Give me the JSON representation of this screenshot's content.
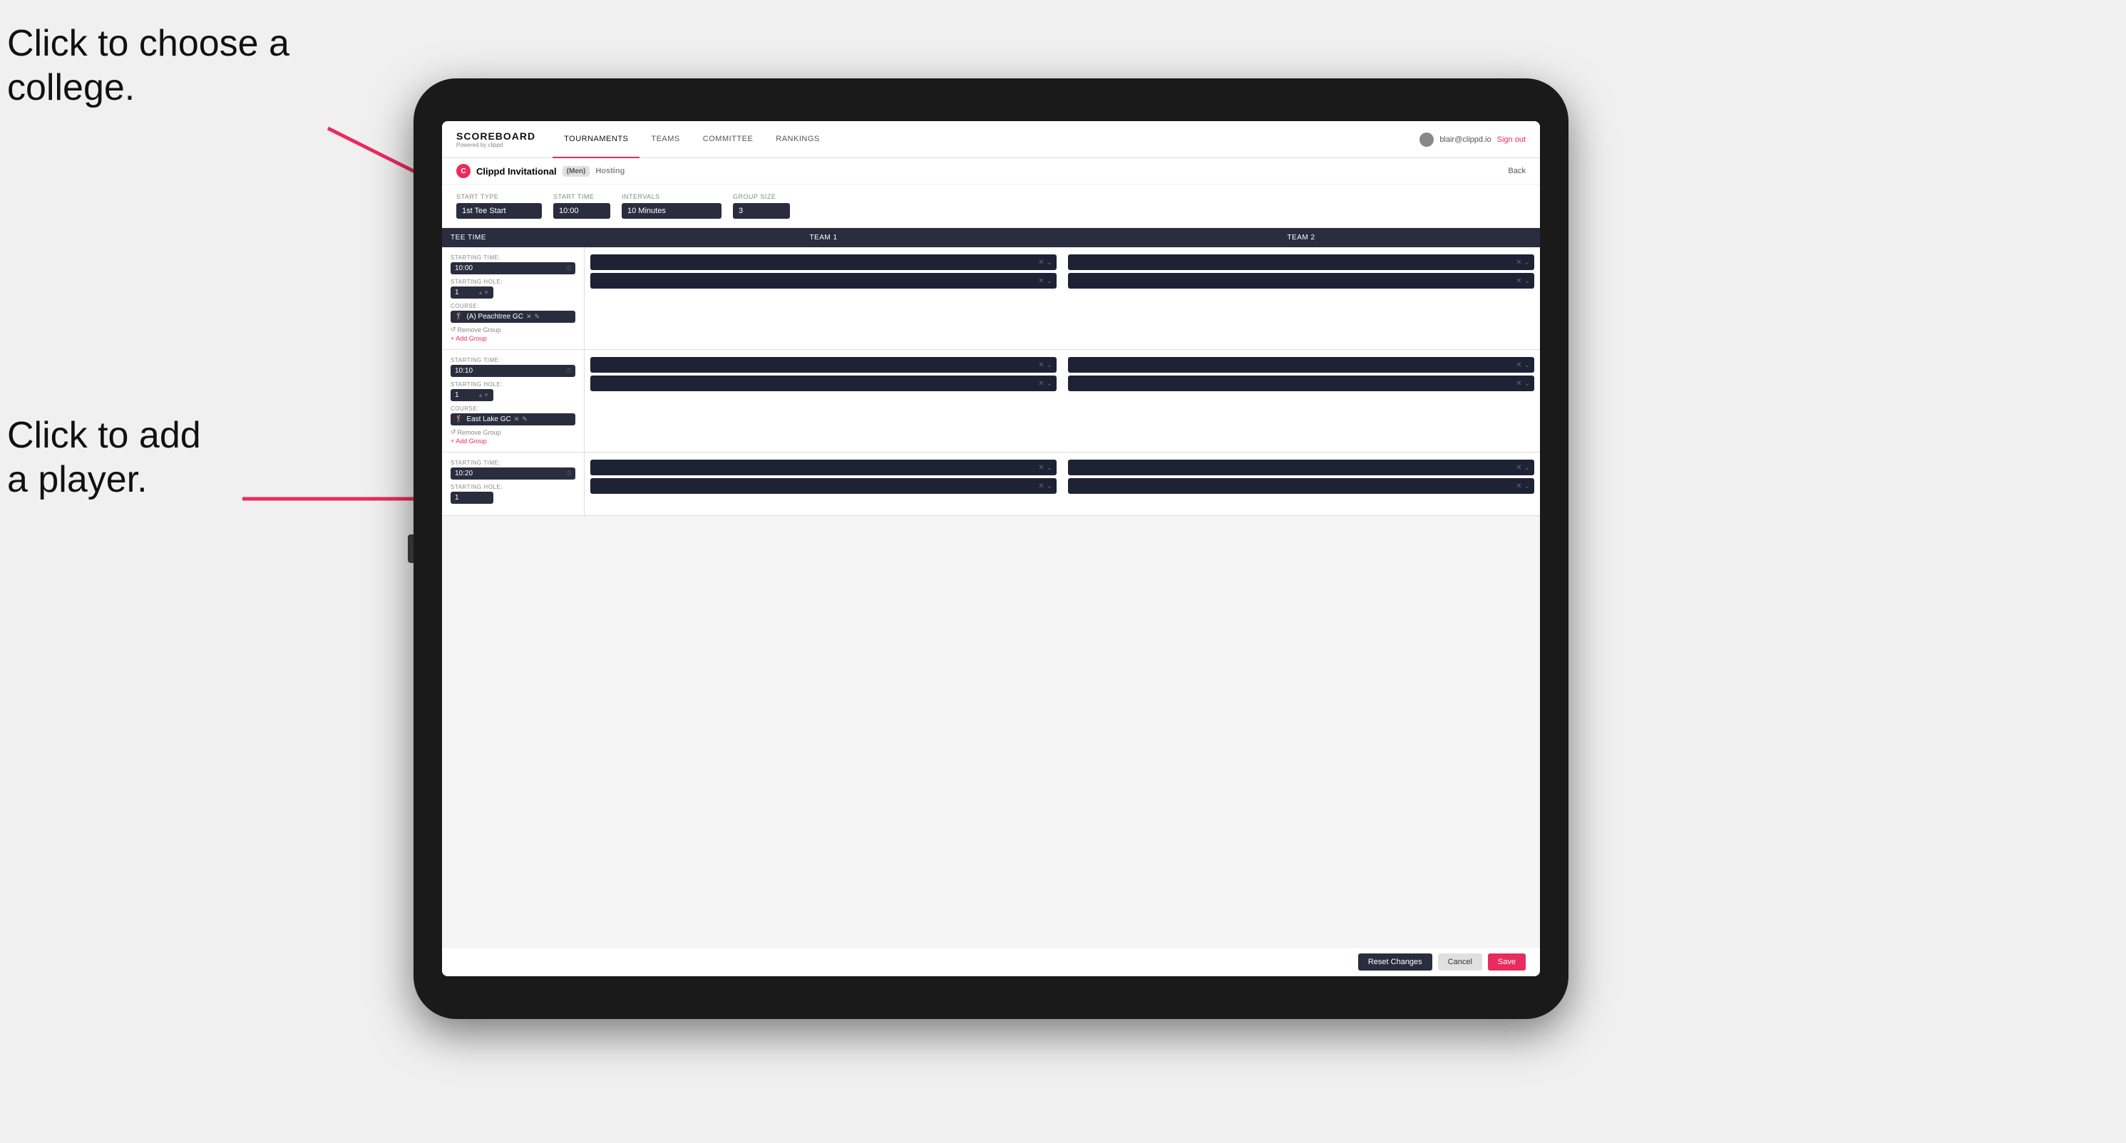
{
  "annotations": {
    "text1_line1": "Click to choose a",
    "text1_line2": "college.",
    "text2_line1": "Click to add",
    "text2_line2": "a player."
  },
  "header": {
    "logo": "SCOREBOARD",
    "logo_sub": "Powered by clippd",
    "nav": [
      "TOURNAMENTS",
      "TEAMS",
      "COMMITTEE",
      "RANKINGS"
    ],
    "active_nav": "TOURNAMENTS",
    "user_email": "blair@clippd.io",
    "sign_out": "Sign out"
  },
  "sub_header": {
    "tournament": "Clippd Invitational",
    "gender": "(Men)",
    "hosting": "Hosting",
    "back": "Back"
  },
  "controls": {
    "start_type_label": "Start Type",
    "start_type_value": "1st Tee Start",
    "start_time_label": "Start Time",
    "start_time_value": "10:00",
    "intervals_label": "Intervals",
    "intervals_value": "10 Minutes",
    "group_size_label": "Group Size",
    "group_size_value": "3"
  },
  "table_headers": {
    "tee_time": "Tee Time",
    "team1": "Team 1",
    "team2": "Team 2"
  },
  "rows": [
    {
      "starting_time": "10:00",
      "starting_hole": "1",
      "course": "(A) Peachtree GC",
      "remove_group": "Remove Group",
      "add_group": "Add Group",
      "team1_slots": 2,
      "team2_slots": 2
    },
    {
      "starting_time": "10:10",
      "starting_hole": "1",
      "course": "East Lake GC",
      "remove_group": "Remove Group",
      "add_group": "Add Group",
      "team1_slots": 2,
      "team2_slots": 2
    },
    {
      "starting_time": "10:20",
      "starting_hole": "",
      "course": "",
      "remove_group": "",
      "add_group": "",
      "team1_slots": 2,
      "team2_slots": 2
    }
  ],
  "footer": {
    "reset": "Reset Changes",
    "cancel": "Cancel",
    "save": "Save"
  }
}
